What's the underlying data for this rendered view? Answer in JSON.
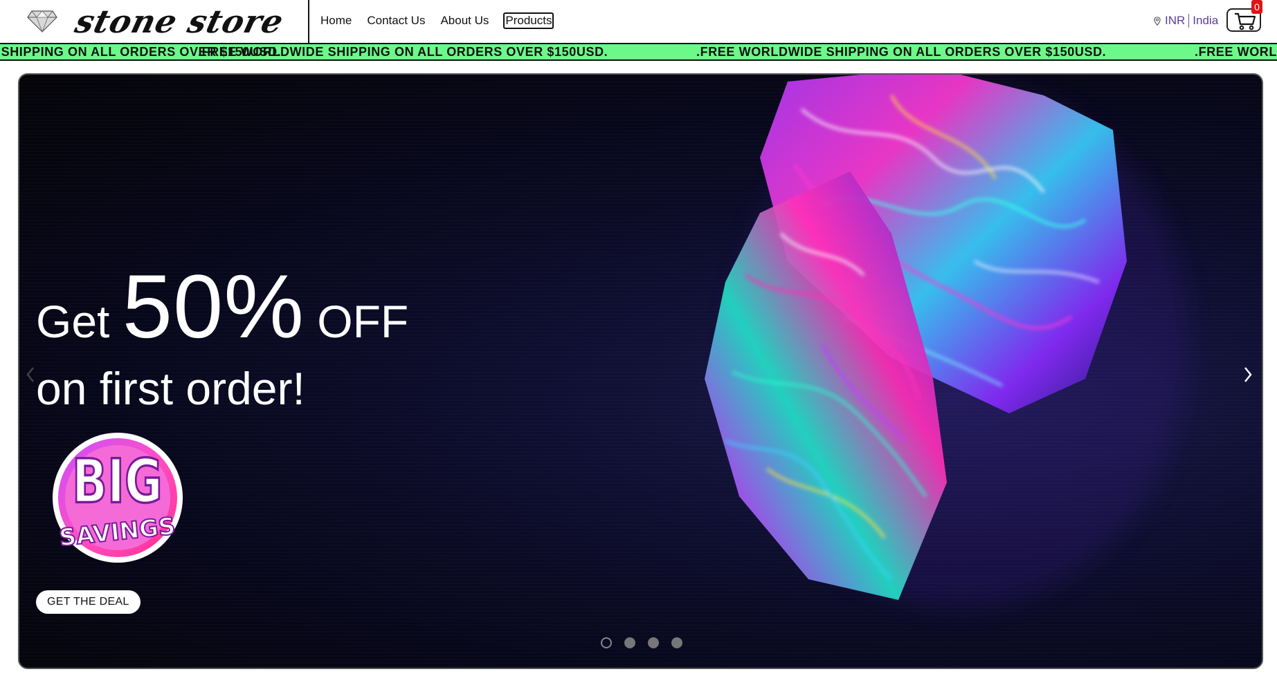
{
  "header": {
    "brand": "stone store",
    "nav": [
      {
        "label": "Home"
      },
      {
        "label": "Contact Us"
      },
      {
        "label": "About Us"
      },
      {
        "label": "Products",
        "active": true
      }
    ],
    "locale": {
      "currency": "INR",
      "country": "India"
    },
    "cart": {
      "count": "0"
    }
  },
  "ticker": {
    "text": ".FREE WORLDWIDE SHIPPING ON ALL ORDERS OVER $150USD."
  },
  "hero": {
    "headline_prefix": "Get",
    "headline_big": "50%",
    "headline_suffix": "OFF",
    "headline_line2": "on first order!",
    "badge_line1": "BIG",
    "badge_line2": "SAVINGS",
    "cta_label": "GET THE DEAL",
    "slides": 4,
    "active_slide": 1
  },
  "colors": {
    "ticker_bg": "#6bf98a",
    "locale_text": "#5a3d9a",
    "cart_badge": "#e01414"
  }
}
